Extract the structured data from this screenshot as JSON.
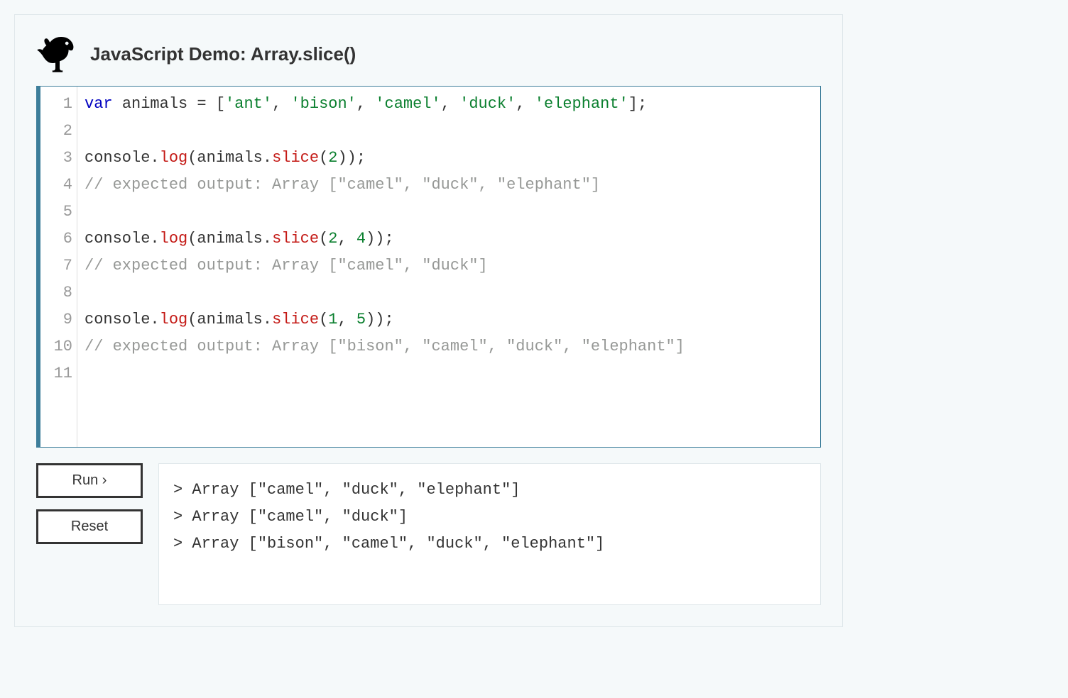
{
  "header": {
    "title": "JavaScript Demo: Array.slice()"
  },
  "editor": {
    "line_numbers": [
      "1",
      "2",
      "3",
      "4",
      "5",
      "6",
      "7",
      "8",
      "9",
      "10",
      "11"
    ],
    "lines": [
      [
        {
          "t": "var",
          "c": "kw"
        },
        {
          "t": " ",
          "c": "punct"
        },
        {
          "t": "animals",
          "c": "id"
        },
        {
          "t": " = [",
          "c": "punct"
        },
        {
          "t": "'ant'",
          "c": "str"
        },
        {
          "t": ", ",
          "c": "punct"
        },
        {
          "t": "'bison'",
          "c": "str"
        },
        {
          "t": ", ",
          "c": "punct"
        },
        {
          "t": "'camel'",
          "c": "str"
        },
        {
          "t": ", ",
          "c": "punct"
        },
        {
          "t": "'duck'",
          "c": "str"
        },
        {
          "t": ", ",
          "c": "punct"
        },
        {
          "t": "'elephant'",
          "c": "str"
        },
        {
          "t": "];",
          "c": "punct"
        }
      ],
      [],
      [
        {
          "t": "console.",
          "c": "id"
        },
        {
          "t": "log",
          "c": "fn"
        },
        {
          "t": "(animals.",
          "c": "punct"
        },
        {
          "t": "slice",
          "c": "fn"
        },
        {
          "t": "(",
          "c": "punct"
        },
        {
          "t": "2",
          "c": "num"
        },
        {
          "t": "));",
          "c": "punct"
        }
      ],
      [
        {
          "t": "// expected output: Array [\"camel\", \"duck\", \"elephant\"]",
          "c": "comment"
        }
      ],
      [],
      [
        {
          "t": "console.",
          "c": "id"
        },
        {
          "t": "log",
          "c": "fn"
        },
        {
          "t": "(animals.",
          "c": "punct"
        },
        {
          "t": "slice",
          "c": "fn"
        },
        {
          "t": "(",
          "c": "punct"
        },
        {
          "t": "2",
          "c": "num"
        },
        {
          "t": ", ",
          "c": "punct"
        },
        {
          "t": "4",
          "c": "num"
        },
        {
          "t": "));",
          "c": "punct"
        }
      ],
      [
        {
          "t": "// expected output: Array [\"camel\", \"duck\"]",
          "c": "comment"
        }
      ],
      [],
      [
        {
          "t": "console.",
          "c": "id"
        },
        {
          "t": "log",
          "c": "fn"
        },
        {
          "t": "(animals.",
          "c": "punct"
        },
        {
          "t": "slice",
          "c": "fn"
        },
        {
          "t": "(",
          "c": "punct"
        },
        {
          "t": "1",
          "c": "num"
        },
        {
          "t": ", ",
          "c": "punct"
        },
        {
          "t": "5",
          "c": "num"
        },
        {
          "t": "));",
          "c": "punct"
        }
      ],
      [
        {
          "t": "// expected output: Array [\"bison\", \"camel\", \"duck\", \"elephant\"]",
          "c": "comment"
        }
      ],
      []
    ]
  },
  "controls": {
    "run_label": "Run ›",
    "reset_label": "Reset"
  },
  "output": {
    "lines": [
      "> Array [\"camel\", \"duck\", \"elephant\"]",
      "> Array [\"camel\", \"duck\"]",
      "> Array [\"bison\", \"camel\", \"duck\", \"elephant\"]"
    ]
  }
}
